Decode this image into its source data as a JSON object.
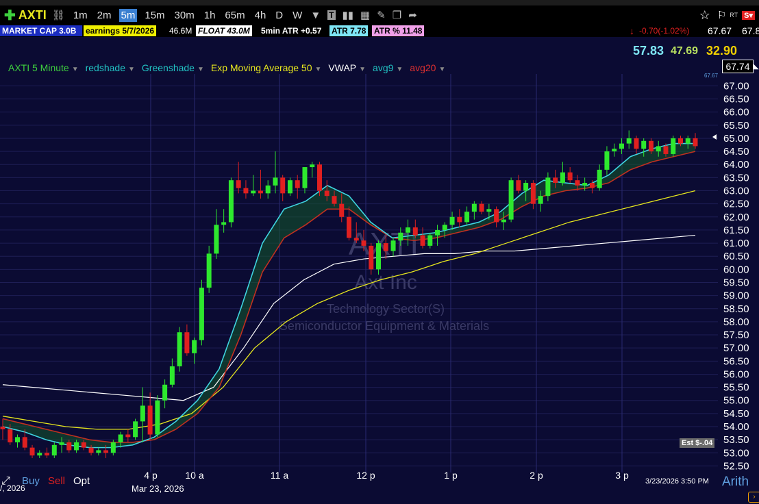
{
  "toolbar": {
    "symbol": "AXTI",
    "timeframes": [
      "1m",
      "2m",
      "5m",
      "15m",
      "30m",
      "1h",
      "65m",
      "4h",
      "D",
      "W"
    ],
    "active_timeframe": "5m"
  },
  "infobar": {
    "market_cap": "MARKET CAP 3.0B",
    "earnings": "earnings 5/7/2026",
    "volume": "46.6M",
    "float": "FLOAT 43.0M",
    "atr5": "5min ATR +0.57",
    "atr": "ATR 7.78",
    "atr_pct": "ATR % 11.48",
    "change": "-0.70(-1.02%)",
    "last": "67.67",
    "last2": "67.8"
  },
  "quotes": {
    "q1": "57.83",
    "q2": "47.69",
    "q3": "32.90"
  },
  "legend": {
    "items": [
      {
        "label": "AXTI 5 Minute",
        "color": "#3ecf3e"
      },
      {
        "label": "redshade",
        "color": "#22c4c4"
      },
      {
        "label": "Greenshade",
        "color": "#22c4c4"
      },
      {
        "label": "Exp Moving Average 50",
        "color": "#e6e61e"
      },
      {
        "label": "VWAP",
        "color": "#ffffff"
      },
      {
        "label": "avg9",
        "color": "#22c4c4"
      },
      {
        "label": "avg20",
        "color": "#e03030"
      }
    ]
  },
  "watermark": {
    "symbol": "AXTI",
    "company": "Axt Inc",
    "sector": "Technology Sector(S)",
    "industry": "Semiconductor Equipment & Materials"
  },
  "price_box": "67.74",
  "price_small": "67.67",
  "est_label": "Est $-.04",
  "timestamp": "3/23/2026 3:50 PM",
  "scale_mode": "Arith",
  "date_label": "Mar 23, 2026",
  "partial_date": "/, 2026",
  "trade_buttons": {
    "buy": "Buy",
    "sell": "Sell",
    "opt": "Opt"
  },
  "chart_data": {
    "type": "candlestick",
    "ylim": [
      52.25,
      67.35
    ],
    "y_ticks": [
      "67.00",
      "66.50",
      "66.00",
      "65.50",
      "65.00",
      "64.50",
      "64.00",
      "63.50",
      "63.00",
      "62.50",
      "62.00",
      "61.50",
      "61.00",
      "60.50",
      "60.00",
      "59.50",
      "59.00",
      "58.50",
      "58.00",
      "57.50",
      "57.00",
      "56.50",
      "56.00",
      "55.50",
      "55.00",
      "54.50",
      "54.00",
      "53.50",
      "53.00",
      "52.50"
    ],
    "x_ticks": [
      "4 p",
      "10 a",
      "11 a",
      "12 p",
      "1 p",
      "2 p",
      "3 p"
    ],
    "candles": [
      [
        54.0,
        54.3,
        53.5,
        53.9
      ],
      [
        53.9,
        54.1,
        53.3,
        53.4
      ],
      [
        53.4,
        53.7,
        53.2,
        53.6
      ],
      [
        53.6,
        53.9,
        53.1,
        53.2
      ],
      [
        53.2,
        53.3,
        52.8,
        52.9
      ],
      [
        52.9,
        53.1,
        52.8,
        53.0
      ],
      [
        53.0,
        53.2,
        52.8,
        52.9
      ],
      [
        52.9,
        53.4,
        52.8,
        53.3
      ],
      [
        53.3,
        53.6,
        53.0,
        53.4
      ],
      [
        53.4,
        53.5,
        53.0,
        53.1
      ],
      [
        53.1,
        53.5,
        53.0,
        53.4
      ],
      [
        53.4,
        53.5,
        53.1,
        53.2
      ],
      [
        53.2,
        53.3,
        52.9,
        53.0
      ],
      [
        53.0,
        53.2,
        52.9,
        53.1
      ],
      [
        53.1,
        53.3,
        52.8,
        53.0
      ],
      [
        53.0,
        53.5,
        52.9,
        53.4
      ],
      [
        53.4,
        53.8,
        53.2,
        53.7
      ],
      [
        53.7,
        53.9,
        53.4,
        53.6
      ],
      [
        53.6,
        54.3,
        53.5,
        54.2
      ],
      [
        54.2,
        55.5,
        53.4,
        54.8
      ],
      [
        54.8,
        55.3,
        53.5,
        53.7
      ],
      [
        53.7,
        55.2,
        53.6,
        55.0
      ],
      [
        55.0,
        55.8,
        54.7,
        55.6
      ],
      [
        55.6,
        56.6,
        55.5,
        56.3
      ],
      [
        56.3,
        57.8,
        56.1,
        57.6
      ],
      [
        57.6,
        57.9,
        56.7,
        56.8
      ],
      [
        56.8,
        57.4,
        56.4,
        57.3
      ],
      [
        57.3,
        59.6,
        57.1,
        59.3
      ],
      [
        59.3,
        60.9,
        59.1,
        60.6
      ],
      [
        60.6,
        62.3,
        60.4,
        61.7
      ],
      [
        61.7,
        62.3,
        61.4,
        61.8
      ],
      [
        61.8,
        63.5,
        61.6,
        63.4
      ],
      [
        63.4,
        64.1,
        62.9,
        63.1
      ],
      [
        63.1,
        63.4,
        62.7,
        62.9
      ],
      [
        62.9,
        63.6,
        62.8,
        63.0
      ],
      [
        63.0,
        63.8,
        62.7,
        62.9
      ],
      [
        62.9,
        63.4,
        62.7,
        63.2
      ],
      [
        63.2,
        64.5,
        62.9,
        63.5
      ],
      [
        63.5,
        63.6,
        62.6,
        62.9
      ],
      [
        62.9,
        63.5,
        62.8,
        63.4
      ],
      [
        63.4,
        63.6,
        62.7,
        63.1
      ],
      [
        63.1,
        63.9,
        62.9,
        63.9
      ],
      [
        63.9,
        64.1,
        63.5,
        64.0
      ],
      [
        64.0,
        64.1,
        62.8,
        63.0
      ],
      [
        63.0,
        63.4,
        62.6,
        62.8
      ],
      [
        62.8,
        63.0,
        62.4,
        62.5
      ],
      [
        62.5,
        62.9,
        61.8,
        62.0
      ],
      [
        62.0,
        62.4,
        61.1,
        61.2
      ],
      [
        61.2,
        61.8,
        61.0,
        61.1
      ],
      [
        61.1,
        61.5,
        60.7,
        60.9
      ],
      [
        60.9,
        61.0,
        59.8,
        60.0
      ],
      [
        60.0,
        61.1,
        59.8,
        61.0
      ],
      [
        61.0,
        61.3,
        60.4,
        60.7
      ],
      [
        60.7,
        61.2,
        60.5,
        61.1
      ],
      [
        61.1,
        61.6,
        60.9,
        61.4
      ],
      [
        61.4,
        61.9,
        60.9,
        61.6
      ],
      [
        61.6,
        61.9,
        61.2,
        61.3
      ],
      [
        61.3,
        61.6,
        60.8,
        60.9
      ],
      [
        60.9,
        61.4,
        60.8,
        61.3
      ],
      [
        61.3,
        61.7,
        60.9,
        61.5
      ],
      [
        61.5,
        61.8,
        61.2,
        61.7
      ],
      [
        61.7,
        62.2,
        61.5,
        62.0
      ],
      [
        62.0,
        62.3,
        61.6,
        61.8
      ],
      [
        61.8,
        62.4,
        61.7,
        62.2
      ],
      [
        62.2,
        62.6,
        61.9,
        62.5
      ],
      [
        62.5,
        62.6,
        62.1,
        62.2
      ],
      [
        62.2,
        62.5,
        61.9,
        62.3
      ],
      [
        62.3,
        62.4,
        61.6,
        61.8
      ],
      [
        61.8,
        62.2,
        61.5,
        61.9
      ],
      [
        61.9,
        63.5,
        61.8,
        63.4
      ],
      [
        63.4,
        63.6,
        62.9,
        63.0
      ],
      [
        63.0,
        63.4,
        62.6,
        63.3
      ],
      [
        63.3,
        63.4,
        62.3,
        62.5
      ],
      [
        62.5,
        63.0,
        62.2,
        62.8
      ],
      [
        62.8,
        63.7,
        62.6,
        63.5
      ],
      [
        63.5,
        63.8,
        63.1,
        63.3
      ],
      [
        63.3,
        64.1,
        63.2,
        63.7
      ],
      [
        63.7,
        63.9,
        63.3,
        63.4
      ],
      [
        63.4,
        63.6,
        63.0,
        63.2
      ],
      [
        63.2,
        63.5,
        63.0,
        63.3
      ],
      [
        63.3,
        63.4,
        62.9,
        63.1
      ],
      [
        63.1,
        64.0,
        63.0,
        63.8
      ],
      [
        63.8,
        64.7,
        63.6,
        64.5
      ],
      [
        64.5,
        64.8,
        64.3,
        64.6
      ],
      [
        64.6,
        65.0,
        64.4,
        64.8
      ],
      [
        64.8,
        65.3,
        64.6,
        65.0
      ],
      [
        65.0,
        65.1,
        64.4,
        64.6
      ],
      [
        64.6,
        65.0,
        64.3,
        64.9
      ],
      [
        64.9,
        65.0,
        64.4,
        64.5
      ],
      [
        64.5,
        64.9,
        64.3,
        64.7
      ],
      [
        64.7,
        64.8,
        64.3,
        64.4
      ],
      [
        64.4,
        65.1,
        64.3,
        65.0
      ],
      [
        65.0,
        65.1,
        64.7,
        64.8
      ],
      [
        64.8,
        65.1,
        64.6,
        65.0
      ],
      [
        65.0,
        65.2,
        64.6,
        64.7
      ]
    ],
    "vwap": [
      55.6,
      55.5,
      55.4,
      55.3,
      55.2,
      55.1,
      55.0,
      55.5,
      57.0,
      58.7,
      59.6,
      60.2,
      60.4,
      60.5,
      60.6,
      60.6,
      60.7,
      60.7,
      60.8,
      60.9,
      61.0,
      61.1,
      61.2,
      61.3
    ],
    "ema50": [
      54.4,
      54.2,
      54.0,
      53.9,
      53.9,
      54.1,
      54.5,
      55.5,
      57.0,
      58.0,
      58.7,
      59.2,
      59.6,
      59.9,
      60.3,
      60.6,
      61.0,
      61.4,
      61.8,
      62.1,
      62.4,
      62.7,
      63.0
    ],
    "avg9": [
      54.0,
      53.8,
      53.5,
      53.3,
      53.2,
      53.2,
      53.3,
      53.6,
      54.2,
      55.0,
      56.2,
      58.5,
      61.0,
      62.3,
      62.6,
      63.2,
      62.8,
      61.8,
      61.2,
      61.3,
      61.4,
      61.6,
      61.8,
      62.2,
      62.9,
      63.4,
      63.3,
      63.2,
      63.6,
      64.3,
      64.6,
      64.8,
      64.8
    ],
    "avg20": [
      54.3,
      54.1,
      53.9,
      53.7,
      53.5,
      53.4,
      53.4,
      53.5,
      53.9,
      54.5,
      55.5,
      57.5,
      59.9,
      61.2,
      61.7,
      62.3,
      62.3,
      61.7,
      61.2,
      61.1,
      61.2,
      61.4,
      61.6,
      61.9,
      62.4,
      62.8,
      63.0,
      63.1,
      63.3,
      63.8,
      64.1,
      64.3,
      64.5
    ]
  }
}
